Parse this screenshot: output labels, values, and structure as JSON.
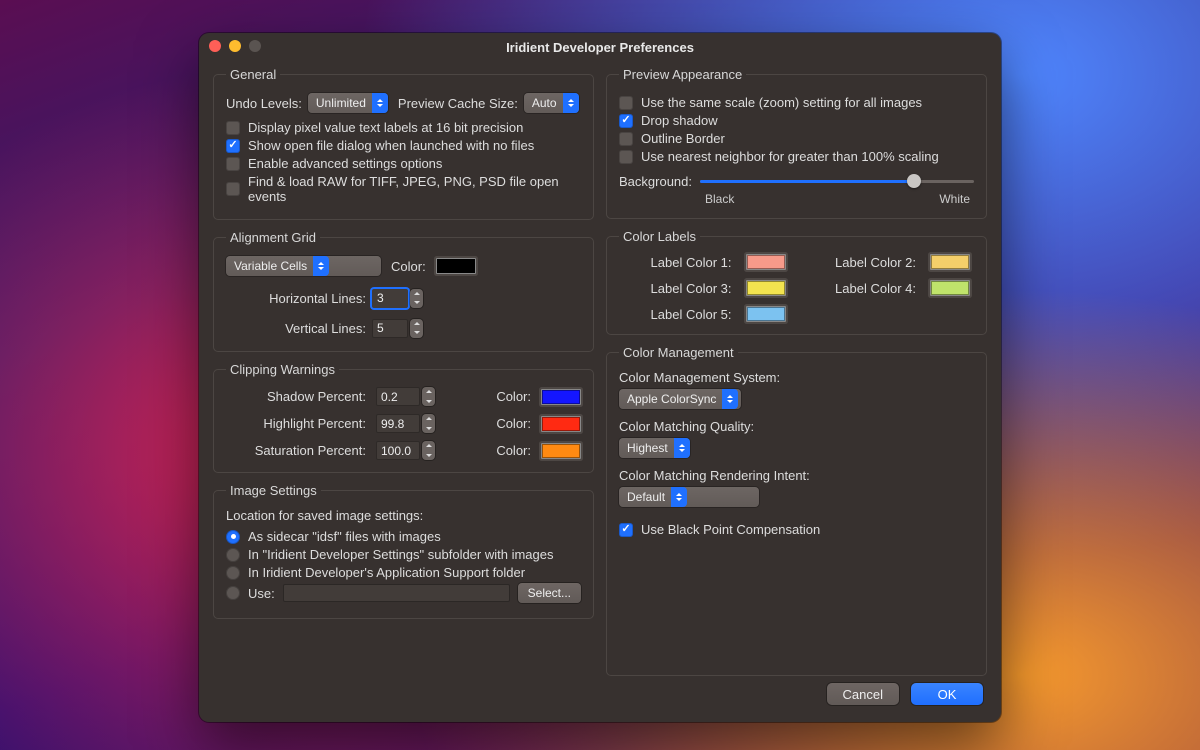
{
  "window": {
    "title": "Iridient Developer Preferences"
  },
  "general": {
    "legend": "General",
    "undo_label": "Undo Levels:",
    "undo_value": "Unlimited",
    "cache_label": "Preview Cache Size:",
    "cache_value": "Auto",
    "chk_pixel": "Display pixel value text labels at 16 bit precision",
    "chk_openfile": "Show open file dialog when launched with no files",
    "chk_advanced": "Enable advanced settings options",
    "chk_findload": "Find & load RAW for TIFF, JPEG, PNG, PSD file open events"
  },
  "align": {
    "legend": "Alignment Grid",
    "type_value": "Variable Cells",
    "color_label": "Color:",
    "color_value": "#000000",
    "hlines_label": "Horizontal Lines:",
    "hlines_value": "3",
    "vlines_label": "Vertical Lines:",
    "vlines_value": "5"
  },
  "clip": {
    "legend": "Clipping Warnings",
    "shadow_label": "Shadow Percent:",
    "shadow_value": "0.2",
    "shadow_color": "#1416ff",
    "highlight_label": "Highlight Percent:",
    "highlight_value": "99.8",
    "highlight_color": "#ff2a12",
    "sat_label": "Saturation Percent:",
    "sat_value": "100.0",
    "sat_color": "#ff8a12",
    "color_label": "Color:"
  },
  "imgset": {
    "legend": "Image Settings",
    "location_label": "Location for saved image settings:",
    "r1": "As sidecar \"idsf\" files with images",
    "r2": "In \"Iridient Developer Settings\" subfolder with images",
    "r3": "In Iridient Developer's Application Support folder",
    "r4": "Use:",
    "select_btn": "Select..."
  },
  "preview": {
    "legend": "Preview Appearance",
    "chk_scale": "Use the same scale (zoom) setting for all images",
    "chk_shadow": "Drop shadow",
    "chk_outline": "Outline Border",
    "chk_nearest": "Use nearest neighbor for greater than 100% scaling",
    "bg_label": "Background:",
    "bg_black": "Black",
    "bg_white": "White",
    "bg_value_pct": 78
  },
  "labels": {
    "legend": "Color Labels",
    "l1": "Label Color 1:",
    "c1": "#f79a8a",
    "l2": "Label Color 2:",
    "c2": "#f4cf6a",
    "l3": "Label Color 3:",
    "c3": "#f2e34f",
    "l4": "Label Color 4:",
    "c4": "#bfe36b",
    "l5": "Label Color 5:",
    "c5": "#7cc2f0"
  },
  "cm": {
    "legend": "Color Management",
    "sys_label": "Color Management System:",
    "sys_value": "Apple ColorSync",
    "qual_label": "Color Matching Quality:",
    "qual_value": "Highest",
    "intent_label": "Color Matching Rendering Intent:",
    "intent_value": "Default",
    "bpc_label": "Use Black Point Compensation"
  },
  "footer": {
    "cancel": "Cancel",
    "ok": "OK"
  }
}
